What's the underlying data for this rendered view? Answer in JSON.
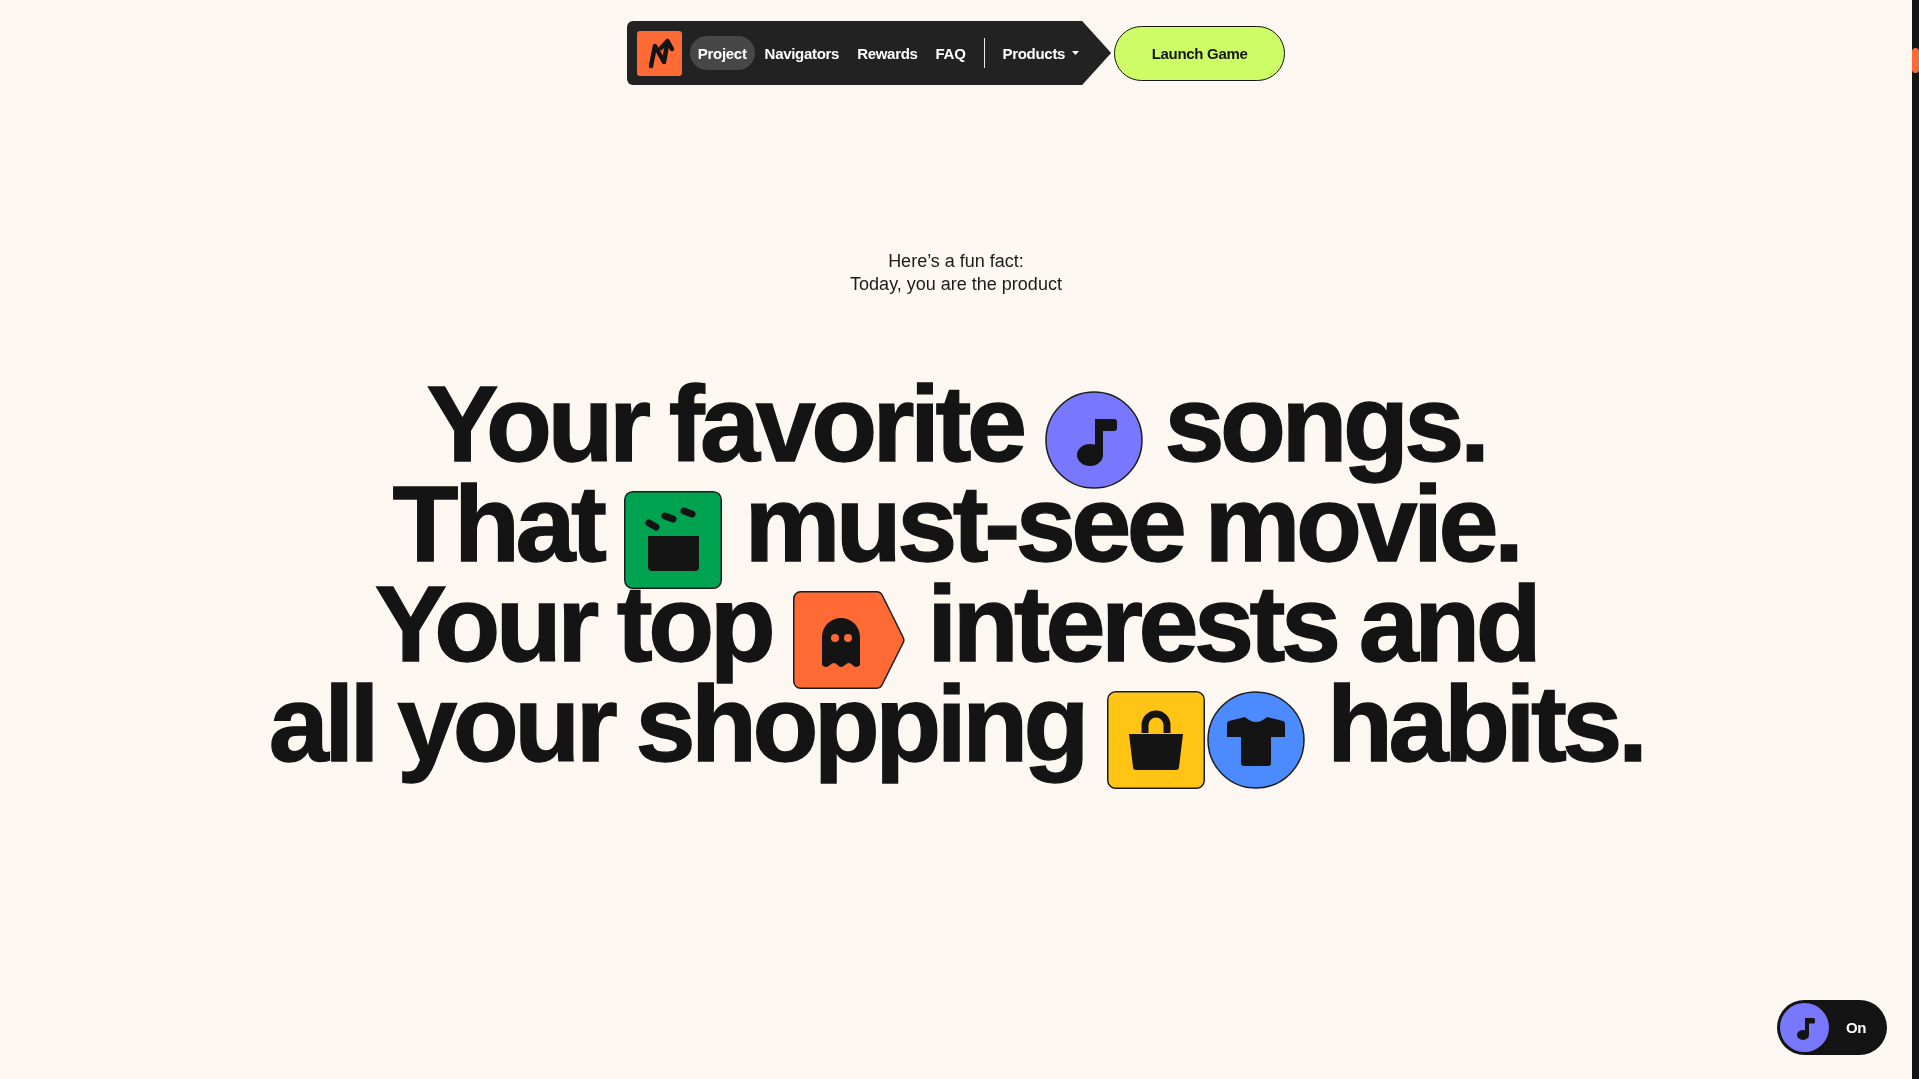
{
  "nav": {
    "links": [
      {
        "label": "Project",
        "selected": true
      },
      {
        "label": "Navigators",
        "selected": false
      },
      {
        "label": "Rewards",
        "selected": false
      },
      {
        "label": "FAQ",
        "selected": false
      }
    ],
    "menu": {
      "label": "Products"
    }
  },
  "cta": {
    "label": "Launch Game"
  },
  "intro": {
    "lines": [
      "Here’s a fun fact:",
      "Today, you are the product"
    ]
  },
  "headline": {
    "lines": [
      [
        {
          "kind": "text",
          "text": "Your favorite"
        },
        {
          "kind": "note",
          "color": "#7878ff"
        },
        {
          "kind": "text",
          "text": "songs."
        }
      ],
      [
        {
          "kind": "text",
          "text": "That"
        },
        {
          "kind": "clapper",
          "color": "#00a34f"
        },
        {
          "kind": "text",
          "text": "must-see movie."
        }
      ],
      [
        {
          "kind": "text",
          "text": "Your top"
        },
        {
          "kind": "ghost",
          "color": "#ff6a35"
        },
        {
          "kind": "text",
          "text": "interests and"
        }
      ],
      [
        {
          "kind": "text",
          "text": "all your shopping"
        },
        {
          "kind": "bag",
          "color": "#ffc414"
        },
        {
          "kind": "shirt",
          "color": "#4b8bff"
        },
        {
          "kind": "text",
          "text": "habits."
        }
      ]
    ]
  },
  "sound_toggle": {
    "label": "On"
  }
}
